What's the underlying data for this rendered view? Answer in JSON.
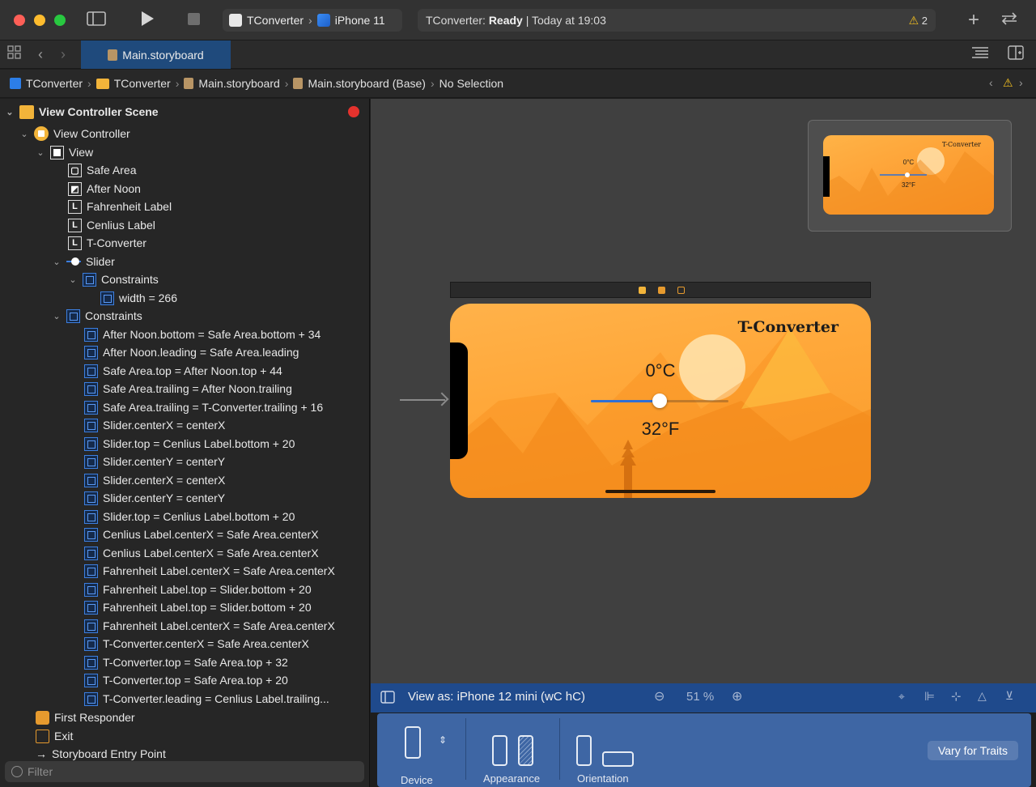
{
  "toolbar": {
    "scheme_app": "TConverter",
    "scheme_device": "iPhone 11",
    "status_prefix": "TConverter: ",
    "status_state": "Ready",
    "status_suffix": " | Today at 19:03",
    "warning_count": "2"
  },
  "tabs": [
    {
      "label": "Main.storyboard"
    }
  ],
  "jumpbar": {
    "crumbs": [
      "TConverter",
      "TConverter",
      "Main.storyboard",
      "Main.storyboard (Base)",
      "No Selection"
    ]
  },
  "outline": {
    "items": [
      {
        "label": "View Controller Scene"
      },
      {
        "label": "View Controller"
      },
      {
        "label": "View"
      },
      {
        "label": "Safe Area"
      },
      {
        "label": "After Noon"
      },
      {
        "label": "Fahrenheit Label"
      },
      {
        "label": "Cenlius Label"
      },
      {
        "label": "T-Converter"
      },
      {
        "label": "Slider"
      },
      {
        "label": "Constraints"
      },
      {
        "label": "width = 266"
      },
      {
        "label": "Constraints"
      },
      {
        "label": "After Noon.bottom = Safe Area.bottom + 34"
      },
      {
        "label": "After Noon.leading = Safe Area.leading"
      },
      {
        "label": "Safe Area.top = After Noon.top + 44"
      },
      {
        "label": "Safe Area.trailing = After Noon.trailing"
      },
      {
        "label": "Safe Area.trailing = T-Converter.trailing + 16"
      },
      {
        "label": "Slider.centerX = centerX"
      },
      {
        "label": "Slider.top = Cenlius Label.bottom + 20"
      },
      {
        "label": "Slider.centerY = centerY"
      },
      {
        "label": "Slider.centerX = centerX"
      },
      {
        "label": "Slider.centerY = centerY"
      },
      {
        "label": "Slider.top = Cenlius Label.bottom + 20"
      },
      {
        "label": "Cenlius Label.centerX = Safe Area.centerX"
      },
      {
        "label": "Cenlius Label.centerX = Safe Area.centerX"
      },
      {
        "label": "Fahrenheit Label.centerX = Safe Area.centerX"
      },
      {
        "label": "Fahrenheit Label.top = Slider.bottom + 20"
      },
      {
        "label": "Fahrenheit Label.top = Slider.bottom + 20"
      },
      {
        "label": "Fahrenheit Label.centerX = Safe Area.centerX"
      },
      {
        "label": "T-Converter.centerX = Safe Area.centerX"
      },
      {
        "label": "T-Converter.top = Safe Area.top + 32"
      },
      {
        "label": "T-Converter.top = Safe Area.top + 20"
      },
      {
        "label": "T-Converter.leading = Cenlius Label.trailing..."
      },
      {
        "label": "First Responder"
      },
      {
        "label": "Exit"
      },
      {
        "label": "Storyboard Entry Point"
      }
    ],
    "filter_placeholder": "Filter"
  },
  "canvas": {
    "app_title": "T-Converter",
    "celsius_text": "0°C",
    "fahrenheit_text": "32°F",
    "slider_fraction": 0.5
  },
  "bottom_bar": {
    "view_as": "View as: iPhone 12 mini (wC hC)",
    "zoom": "51 %"
  },
  "device_panel": {
    "device_label": "Device",
    "appearance_label": "Appearance",
    "orientation_label": "Orientation",
    "vary_button": "Vary for Traits"
  },
  "colors": {
    "accent_tab": "#1f4a7c",
    "bottom_bar": "#1f4a8c",
    "scene_orange": "#ffa83a",
    "error_red": "#e5322d",
    "warning_yellow": "#f4c020"
  }
}
